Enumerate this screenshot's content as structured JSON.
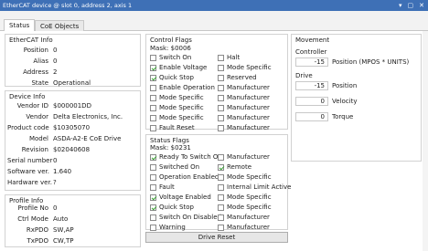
{
  "window": {
    "title": "EtherCAT device @ slot 0, address 2, axis 1",
    "controls": [
      "▾",
      "▢",
      "✕"
    ]
  },
  "tabs": [
    {
      "label": "Status"
    },
    {
      "label": "CoE Objects"
    }
  ],
  "ethercat_info": {
    "title": "EtherCAT Info",
    "position": {
      "label": "Position",
      "value": "0"
    },
    "alias": {
      "label": "Alias",
      "value": "0"
    },
    "address": {
      "label": "Address",
      "value": "2"
    },
    "state": {
      "label": "State",
      "value": "Operational"
    }
  },
  "device_info": {
    "title": "Device Info",
    "vendor_id": {
      "label": "Vendor ID",
      "value": "$000001DD"
    },
    "vendor": {
      "label": "Vendor",
      "value": "Delta Electronics, Inc."
    },
    "product_code": {
      "label": "Product code",
      "value": "$10305070"
    },
    "model": {
      "label": "Model",
      "value": "ASDA-A2-E CoE Drive"
    },
    "revision": {
      "label": "Revision",
      "value": "$02040608"
    },
    "serial": {
      "label": "Serial number",
      "value": "0"
    },
    "software": {
      "label": "Software ver.",
      "value": "1.640"
    },
    "hardware": {
      "label": "Hardware ver.",
      "value": "?"
    }
  },
  "profile_info": {
    "title": "Profile Info",
    "profile_no": {
      "label": "Profile No",
      "value": "0"
    },
    "ctrl_mode": {
      "label": "Ctrl Mode",
      "value": "Auto"
    },
    "rxpdo": {
      "label": "RxPDO",
      "value": "SW,AP"
    },
    "txpdo": {
      "label": "TxPDO",
      "value": "CW,TP"
    }
  },
  "control_flags": {
    "title": "Control Flags",
    "mask": "Mask: $0006",
    "col1": [
      {
        "label": "Switch On",
        "checked": false
      },
      {
        "label": "Enable Voltage",
        "checked": true
      },
      {
        "label": "Quick Stop",
        "checked": true
      },
      {
        "label": "Enable Operation",
        "checked": false
      },
      {
        "label": "Mode Specific",
        "checked": false
      },
      {
        "label": "Mode Specific",
        "checked": false
      },
      {
        "label": "Mode Specific",
        "checked": false
      },
      {
        "label": "Fault Reset",
        "checked": false
      }
    ],
    "col2": [
      {
        "label": "Halt",
        "checked": false
      },
      {
        "label": "Mode Specific",
        "checked": false
      },
      {
        "label": "Reserved",
        "checked": false
      },
      {
        "label": "Manufacturer",
        "checked": false
      },
      {
        "label": "Manufacturer",
        "checked": false
      },
      {
        "label": "Manufacturer",
        "checked": false
      },
      {
        "label": "Manufacturer",
        "checked": false
      },
      {
        "label": "Manufacturer",
        "checked": false
      }
    ]
  },
  "status_flags": {
    "title": "Status Flags",
    "mask": "Mask: $0231",
    "col1": [
      {
        "label": "Ready To Switch On",
        "checked": true
      },
      {
        "label": "Switched On",
        "checked": false
      },
      {
        "label": "Operation Enabled",
        "checked": false
      },
      {
        "label": "Fault",
        "checked": false
      },
      {
        "label": "Voltage Enabled",
        "checked": true
      },
      {
        "label": "Quick Stop",
        "checked": true
      },
      {
        "label": "Switch On Disabled",
        "checked": false
      },
      {
        "label": "Warning",
        "checked": false
      }
    ],
    "col2": [
      {
        "label": "Manufacturer",
        "checked": false
      },
      {
        "label": "Remote",
        "checked": true
      },
      {
        "label": "Mode Specific",
        "checked": false
      },
      {
        "label": "Internal Limit Active",
        "checked": false
      },
      {
        "label": "Mode Specific",
        "checked": false
      },
      {
        "label": "Mode Specific",
        "checked": false
      },
      {
        "label": "Manufacturer",
        "checked": false
      },
      {
        "label": "Manufacturer",
        "checked": false
      }
    ]
  },
  "drive_reset": {
    "label": "Drive Reset"
  },
  "movement": {
    "title": "Movement",
    "controller_title": "Controller",
    "controller_value": "-15",
    "controller_label": "Position (MPOS * UNITS)",
    "drive_title": "Drive",
    "position": {
      "value": "-15",
      "label": "Position"
    },
    "velocity": {
      "value": "0",
      "label": "Velocity"
    },
    "torque": {
      "value": "0",
      "label": "Torque"
    }
  }
}
